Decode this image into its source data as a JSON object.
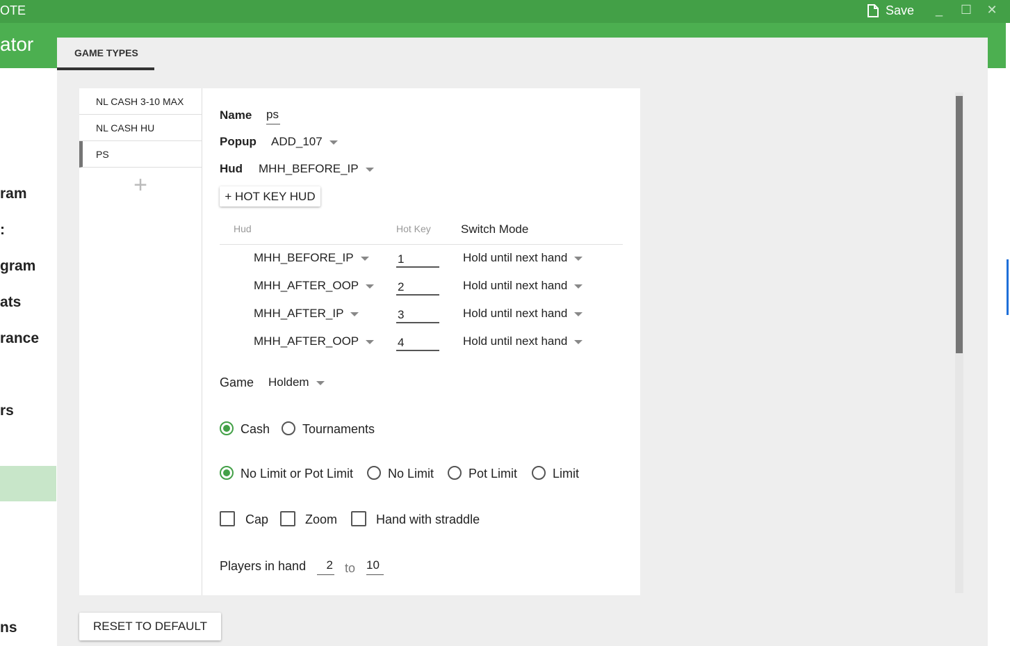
{
  "window": {
    "title": "OTE",
    "save_label": "Save",
    "minimize": "_",
    "maximize": "☐",
    "close": "✕"
  },
  "background": {
    "app_title": "ator",
    "nav_items": [
      "ram",
      ":",
      "gram",
      "ats",
      "rance",
      "rs",
      "ns"
    ]
  },
  "tabs": {
    "game_types": "GAME TYPES"
  },
  "game_types": {
    "items": [
      "NL CASH 3-10 MAX",
      "NL CASH HU",
      "PS"
    ],
    "selected_index": 2,
    "add_icon": "+"
  },
  "form": {
    "name_label": "Name",
    "name_value": "ps",
    "popup_label": "Popup",
    "popup_value": "ADD_107",
    "hud_label": "Hud",
    "hud_value": "MHH_BEFORE_IP",
    "hotkey_button": "+ HOT KEY HUD",
    "table_headers": {
      "hud": "Hud",
      "hotkey": "Hot Key",
      "switch_mode": "Switch Mode"
    },
    "hotkey_rows": [
      {
        "hud": "MHH_BEFORE_IP",
        "key": "1",
        "mode": "Hold until next hand"
      },
      {
        "hud": "MHH_AFTER_OOP",
        "key": "2",
        "mode": "Hold until next hand"
      },
      {
        "hud": "MHH_AFTER_IP",
        "key": "3",
        "mode": "Hold until next hand"
      },
      {
        "hud": "MHH_AFTER_OOP",
        "key": "4",
        "mode": "Hold until next hand"
      }
    ],
    "game_label": "Game",
    "game_value": "Holdem",
    "game_format": {
      "options": [
        "Cash",
        "Tournaments"
      ],
      "selected": "Cash"
    },
    "limit": {
      "options": [
        "No Limit or Pot Limit",
        "No Limit",
        "Pot Limit",
        "Limit"
      ],
      "selected": "No Limit or Pot Limit"
    },
    "checkboxes": [
      {
        "label": "Cap",
        "checked": false
      },
      {
        "label": "Zoom",
        "checked": false
      },
      {
        "label": "Hand with straddle",
        "checked": false
      }
    ],
    "players_label": "Players in hand",
    "players_from": "2",
    "players_to_word": "to",
    "players_to": "10"
  },
  "reset_button": "RESET TO DEFAULT",
  "colors": {
    "accent": "#43a047",
    "header": "#4caf50",
    "panel": "#eeeeee",
    "active_nav": "#c8e6c9"
  }
}
